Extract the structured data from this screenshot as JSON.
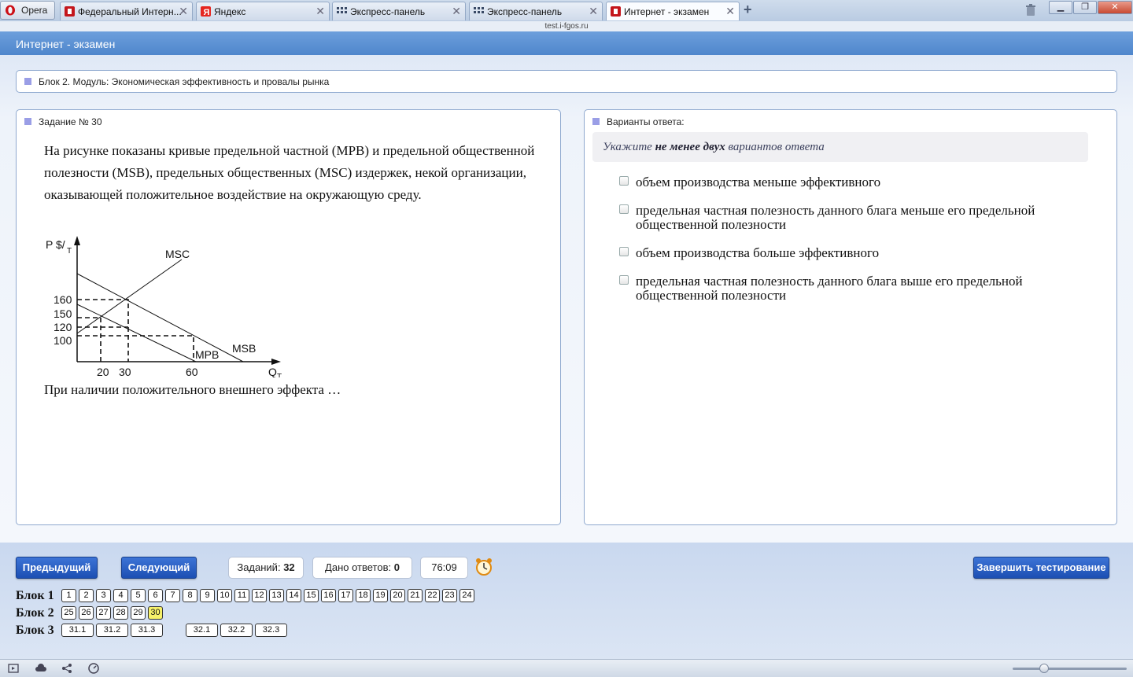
{
  "browser": {
    "opera_label": "Opera",
    "tabs": [
      {
        "label": "Федеральный Интерн...",
        "icon": "fgos-icon"
      },
      {
        "label": "Яндекс",
        "icon": "yandex-icon"
      },
      {
        "label": "Экспресс-панель",
        "icon": "grid-icon"
      },
      {
        "label": "Экспресс-панель",
        "icon": "grid-icon"
      },
      {
        "label": "Интернет - экзамен",
        "icon": "fgos-icon"
      }
    ],
    "new_tab": "+",
    "url": "test.i-fgos.ru"
  },
  "header": {
    "title": "Интернет - экзамен"
  },
  "block": {
    "title": "Блок 2. Модуль: Экономическая эффективность и провалы рынка"
  },
  "task": {
    "label": "Задание № 30",
    "text": "На рисунке показаны кривые предельной частной (MPB) и предельной общественной полезности (MSB), предельных общественных (MSC) издержек, некой организации, оказывающей положительное воздействие на окружающую среду.",
    "question": "При наличии положительного внешнего эффекта …",
    "graph": {
      "y_axis_label": "P $/",
      "y_axis_sub": "T",
      "x_axis_label": "Q",
      "x_axis_sub": "T",
      "y_ticks": [
        "160",
        "150",
        "120",
        "100"
      ],
      "x_ticks": [
        "20",
        "30",
        "60"
      ],
      "curve_msc": "MSC",
      "curve_msb": "MSB",
      "curve_mpb": "MPB"
    }
  },
  "answers": {
    "label": "Варианты ответа:",
    "hint_pre": "Укажите",
    "hint_bold": "не менее двух",
    "hint_post": "вариантов ответа",
    "options": [
      {
        "text": "объем производства меньше эффективного",
        "checked": false
      },
      {
        "text": "предельная частная полезность данного блага меньше его предельной общественной полезности",
        "checked": false
      },
      {
        "text": "объем производства больше эффективного",
        "checked": false
      },
      {
        "text": "предельная частная полезность данного блага выше его предельной общественной полезности",
        "checked": false
      }
    ]
  },
  "footer": {
    "prev": "Предыдущий",
    "next": "Следующий",
    "tasks_label": "Заданий:",
    "tasks_value": "32",
    "answered_label": "Дано ответов:",
    "answered_value": "0",
    "timer": "76:09",
    "finish": "Завершить тестирование",
    "blocks": [
      {
        "label": "Блок 1",
        "items": [
          "1",
          "2",
          "3",
          "4",
          "5",
          "6",
          "7",
          "8",
          "9",
          "10",
          "11",
          "12",
          "13",
          "14",
          "15",
          "16",
          "17",
          "18",
          "19",
          "20",
          "21",
          "22",
          "23",
          "24"
        ]
      },
      {
        "label": "Блок 2",
        "items": [
          "25",
          "26",
          "27",
          "28",
          "29",
          "30"
        ],
        "current": "30"
      },
      {
        "label": "Блок 3",
        "items": [
          "31.1",
          "31.2",
          "31.3",
          "32.1",
          "32.2",
          "32.3"
        ]
      }
    ]
  }
}
